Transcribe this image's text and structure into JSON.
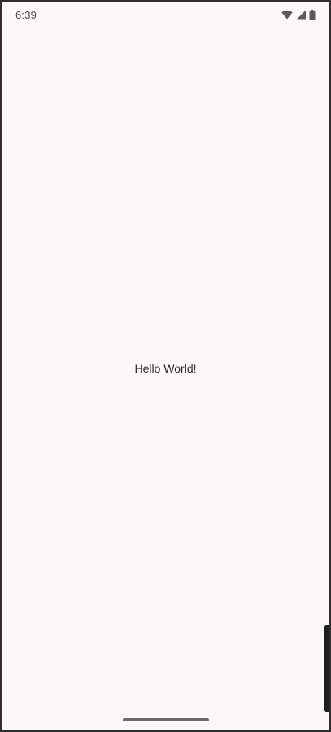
{
  "status_bar": {
    "time": "6:39",
    "icons": [
      "wifi-icon",
      "cellular-signal-icon",
      "battery-icon"
    ]
  },
  "main": {
    "text": "Hello World!"
  },
  "colors": {
    "background": "#fef7fc",
    "text": "#2b2b2b",
    "frame": "#2e2e30"
  }
}
